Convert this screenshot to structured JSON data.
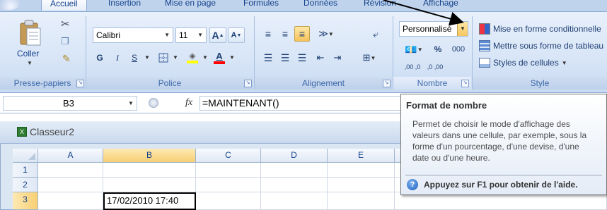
{
  "tabs": [
    "Accueil",
    "Insertion",
    "Mise en page",
    "Formules",
    "Données",
    "Révision",
    "Affichage"
  ],
  "clipboard": {
    "paste_label": "Coller",
    "group_label": "Presse-papiers"
  },
  "font": {
    "name": "Calibri",
    "size": "11",
    "bold": "G",
    "italic": "I",
    "underline": "S",
    "grow": "A",
    "shrink": "A",
    "font_color_letter": "A",
    "group_label": "Police"
  },
  "alignment": {
    "group_label": "Alignement"
  },
  "number": {
    "format_value": "Personnalisé",
    "percent": "%",
    "thousands": "000",
    "inc_decimal": ",00 ,0",
    "dec_decimal": ",0 ,00",
    "group_label": "Nombre"
  },
  "style": {
    "conditional": "Mise en forme conditionnelle",
    "as_table": "Mettre sous forme de tableau",
    "cell_styles": "Styles de cellules",
    "group_label": "Style"
  },
  "formula_bar": {
    "name_box": "B3",
    "fx": "fx",
    "formula": "=MAINTENANT()"
  },
  "workbook": {
    "title": "Classeur2",
    "columns": [
      "A",
      "B",
      "C",
      "D",
      "E"
    ],
    "rows": [
      "1",
      "2",
      "3"
    ],
    "selected_cell_value": "17/02/2010 17:40"
  },
  "tooltip": {
    "title": "Format de nombre",
    "body": "Permet de choisir le mode d'affichage des valeurs dans une cellule, par exemple, sous la forme d'un pourcentage, d'une devise, d'une date ou d'une heure.",
    "help": "Appuyez sur F1 pour obtenir de l'aide."
  },
  "colors": {
    "ribbon": "#d9e6f7",
    "selection_header": "#f8cf74",
    "label_blue": "#15428b"
  }
}
